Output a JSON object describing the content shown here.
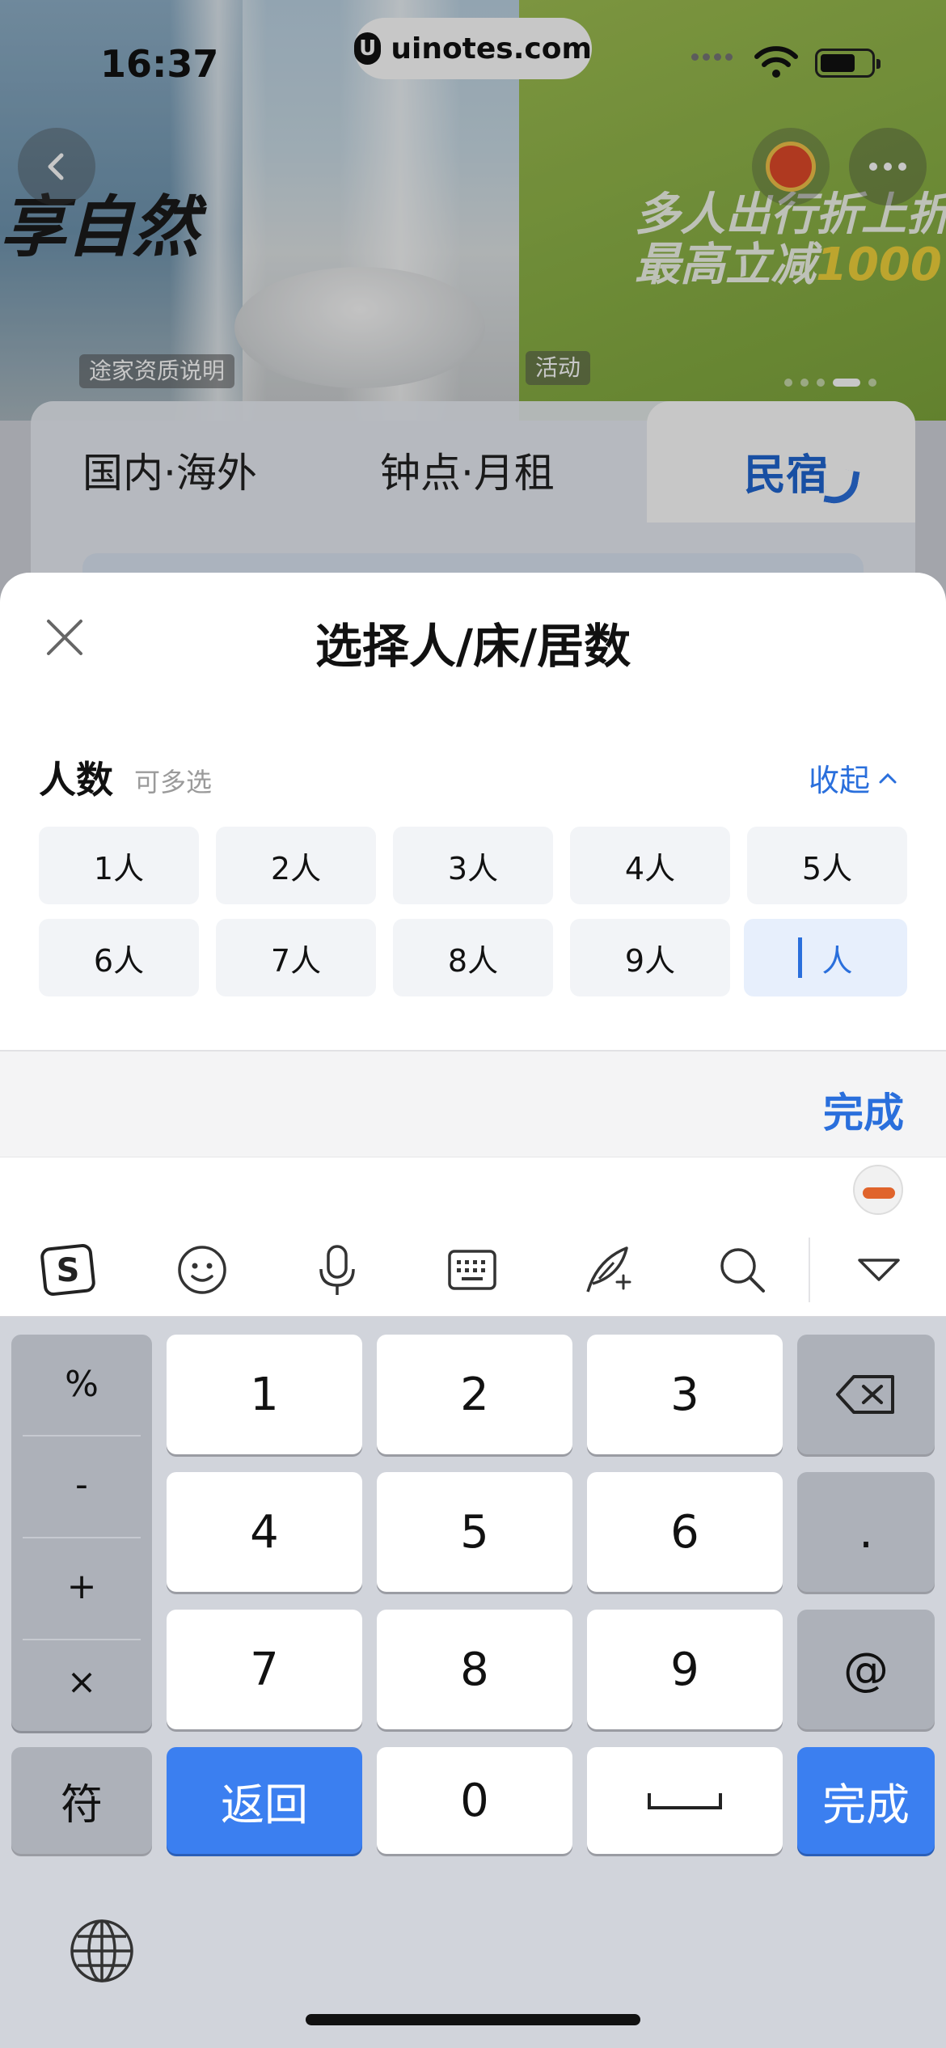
{
  "status_bar": {
    "time": "16:37",
    "url": "uinotes.com"
  },
  "banner": {
    "hero_text": "享自然",
    "left_tag": "途家资质说明",
    "right_tag": "活动",
    "promo_line1": "多人出行折上折",
    "promo_line2_prefix": "最高立减",
    "promo_line2_amount": "1000",
    "carousel_pages": 5,
    "carousel_active": 4
  },
  "tabs": [
    {
      "label": "国内·海外",
      "active": false
    },
    {
      "label": "钟点·月租",
      "active": false
    },
    {
      "label": "民宿",
      "active": true
    }
  ],
  "sheet": {
    "title": "选择人/床/居数",
    "section_label": "人数",
    "section_hint": "可多选",
    "collapse_label": "收起",
    "options": [
      "1人",
      "2人",
      "3人",
      "4人",
      "5人",
      "6人",
      "7人",
      "8人",
      "9人"
    ],
    "custom_option_label": "人"
  },
  "accessory": {
    "done_label": "完成"
  },
  "keyboard": {
    "toolbar_icons": [
      "sogou-logo-icon",
      "emoji-icon",
      "microphone-icon",
      "keyboard-icon",
      "quill-pen-icon",
      "search-icon",
      "chevron-down-icon"
    ],
    "side_keys": [
      "%",
      "-",
      "+",
      "×"
    ],
    "digits": [
      "1",
      "2",
      "3",
      "4",
      "5",
      "6",
      "7",
      "8",
      "9"
    ],
    "symbol_key": "符",
    "back_key": "返回",
    "zero_key": "0",
    "dot_key": ".",
    "at_key": "@",
    "done_key": "完成"
  },
  "colors": {
    "accent": "#2a6fdc",
    "key_blue": "#3b7ff0",
    "key_gray": "#adb1b9"
  }
}
